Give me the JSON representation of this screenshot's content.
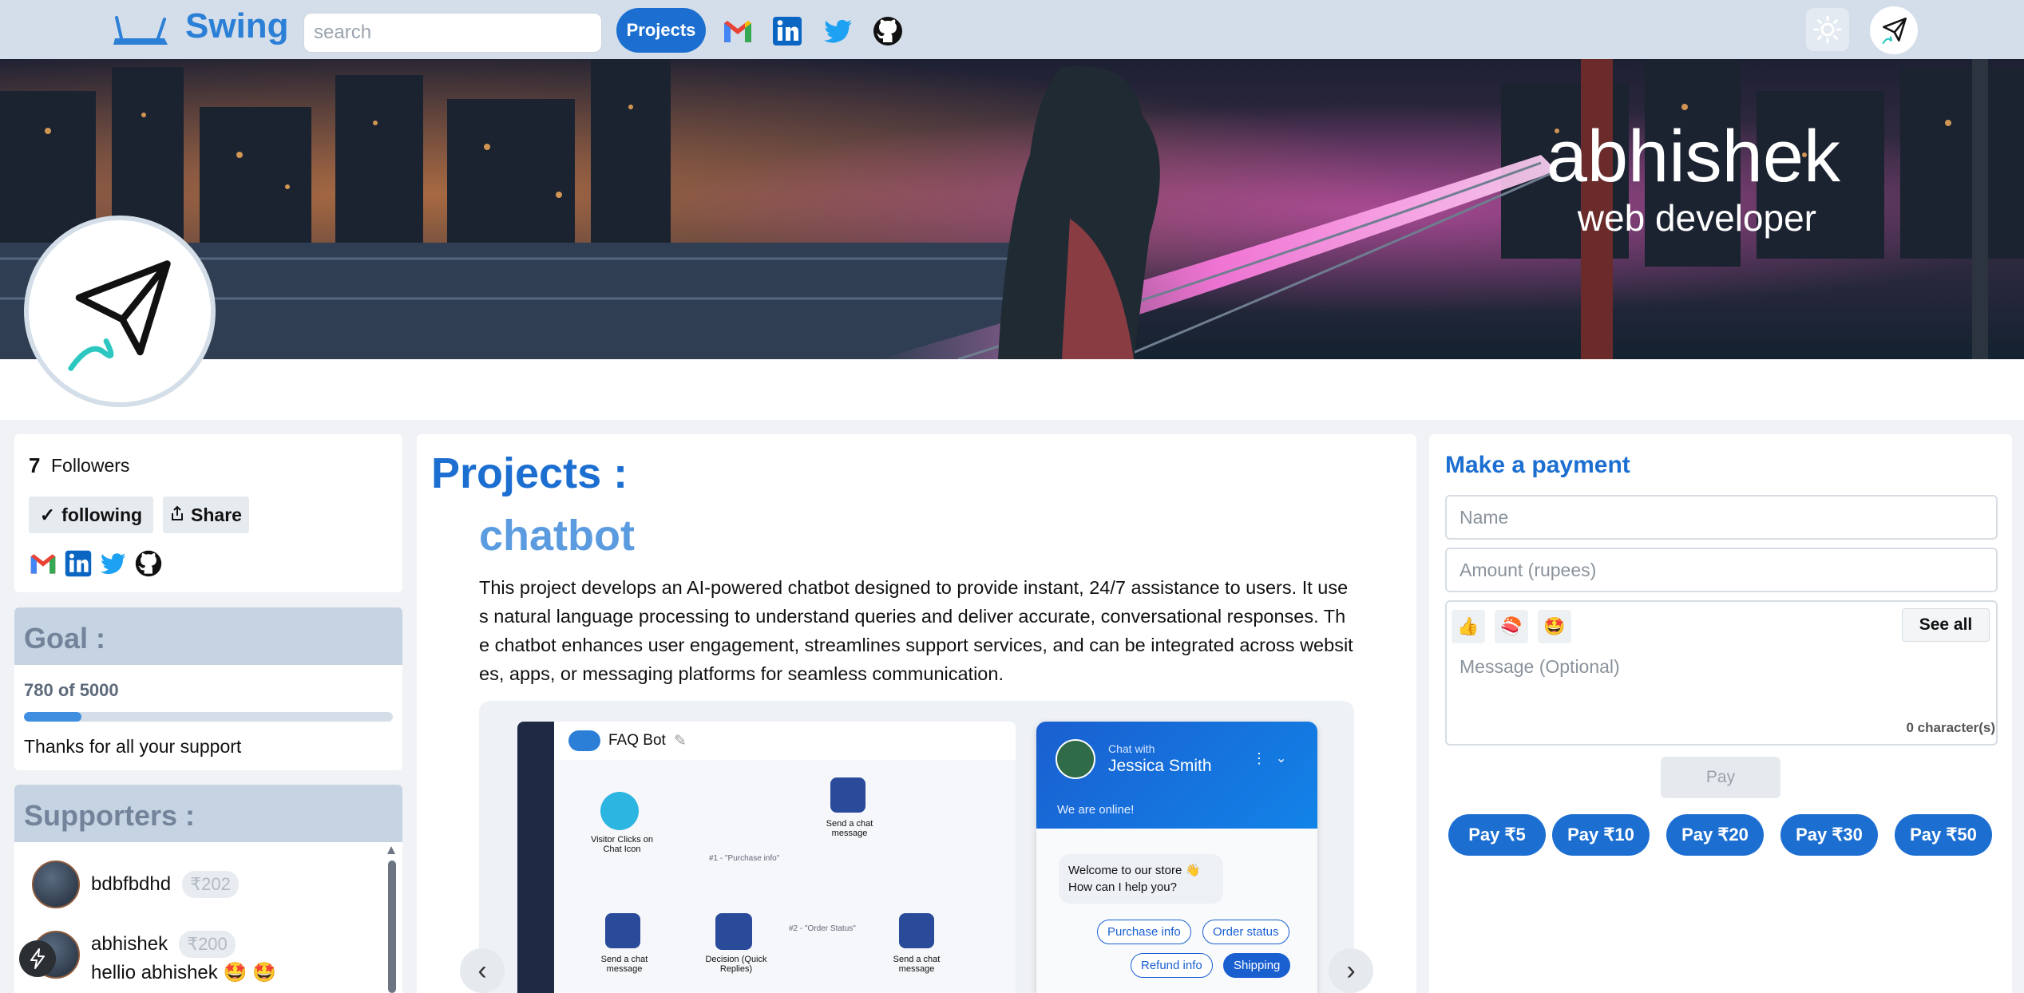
{
  "topbar": {
    "brand": "Swing",
    "search_placeholder": "search",
    "projects_label": "Projects",
    "social_icons": [
      "gmail-icon",
      "linkedin-icon",
      "twitter-icon",
      "github-icon"
    ],
    "theme_icon": "sun-icon",
    "avatar_icon": "paper-plane-icon"
  },
  "banner": {
    "name": "abhishek",
    "role": "web developer"
  },
  "profile": {
    "followers_count": "7",
    "followers_label": "Followers",
    "following_label": "following",
    "share_label": "Share"
  },
  "goal": {
    "title": "Goal :",
    "progress_text": "780 of 5000",
    "raised": 780,
    "target": 5000,
    "message": "Thanks for all your support"
  },
  "supporters": {
    "title": "Supporters :",
    "items": [
      {
        "name": "bdbfbdhd",
        "amount": "₹202",
        "message": ""
      },
      {
        "name": "abhishek",
        "amount": "₹200",
        "message": "hellio abhishek 🤩 🤩"
      }
    ]
  },
  "projects": {
    "title": "Projects :",
    "current": {
      "name": "chatbot",
      "description": "This project develops an AI-powered chatbot designed to provide instant, 24/7 assistance to users. It uses natural language processing to understand queries and deliver accurate, conversational responses. The chatbot enhances user engagement, streamlines support services, and can be integrated across websites, apps, or messaging platforms for seamless communication."
    },
    "screenshot": {
      "bot_title": "FAQ Bot",
      "node_visitor": "Visitor Clicks on Chat Icon",
      "node_send_1": "Send a chat message",
      "node_send_2": "Send a chat message",
      "node_send_3": "Send a chat message",
      "node_decision": "Decision (Quick Replies)",
      "edge_1": "#1 - \"Purchase info\"",
      "edge_2": "#2 - \"Order Status\"",
      "chat_with": "Chat with",
      "agent_name": "Jessica Smith",
      "online": "We are online!",
      "welcome_1": "Welcome to our store 👋",
      "welcome_2": "How can I help you?",
      "quick_replies": [
        "Purchase info",
        "Order status",
        "Refund info",
        "Shipping"
      ]
    }
  },
  "payment": {
    "title": "Make a payment",
    "name_placeholder": "Name",
    "amount_placeholder": "Amount (rupees)",
    "emojis": [
      "👍",
      "🍣",
      "🤩"
    ],
    "see_all_label": "See all",
    "message_placeholder": "Message (Optional)",
    "char_count": "0 character(s)",
    "pay_label": "Pay",
    "quick_amounts": [
      "Pay ₹5",
      "Pay ₹10",
      "Pay ₹20",
      "Pay ₹30",
      "Pay ₹50"
    ]
  }
}
